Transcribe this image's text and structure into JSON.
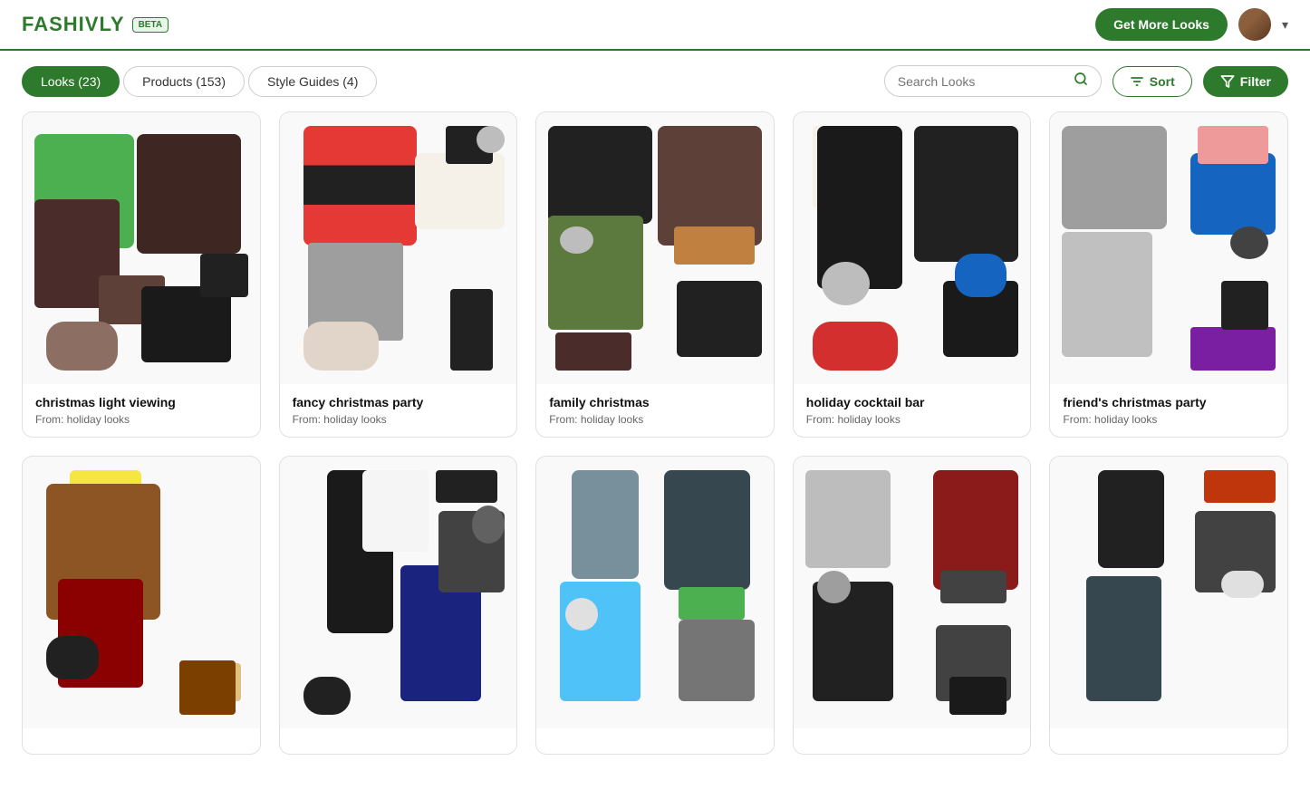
{
  "header": {
    "logo": "FASHIVLY",
    "beta": "BETA",
    "cta_button": "Get More Looks",
    "user_avatar_alt": "User avatar",
    "chevron": "▾"
  },
  "tabs": [
    {
      "id": "looks",
      "label": "Looks (23)",
      "active": true
    },
    {
      "id": "products",
      "label": "Products (153)",
      "active": false
    },
    {
      "id": "style-guides",
      "label": "Style Guides (4)",
      "active": false
    }
  ],
  "search": {
    "placeholder": "Search Looks"
  },
  "toolbar": {
    "sort_label": "Sort",
    "filter_label": "Filter"
  },
  "cards": [
    {
      "id": "card-1",
      "title": "christmas light viewing",
      "subtitle": "From: holiday looks",
      "bg_class": "outfit-bg-1"
    },
    {
      "id": "card-2",
      "title": "fancy christmas party",
      "subtitle": "From: holiday looks",
      "bg_class": "outfit-bg-2"
    },
    {
      "id": "card-3",
      "title": "family christmas",
      "subtitle": "From: holiday looks",
      "bg_class": "outfit-bg-3"
    },
    {
      "id": "card-4",
      "title": "holiday cocktail bar",
      "subtitle": "From: holiday looks",
      "bg_class": "outfit-bg-4"
    },
    {
      "id": "card-5",
      "title": "friend's christmas party",
      "subtitle": "From: holiday looks",
      "bg_class": "outfit-bg-5"
    },
    {
      "id": "card-6",
      "title": "",
      "subtitle": "",
      "bg_class": "outfit-bg-6"
    },
    {
      "id": "card-7",
      "title": "",
      "subtitle": "",
      "bg_class": "outfit-bg-7"
    },
    {
      "id": "card-8",
      "title": "",
      "subtitle": "",
      "bg_class": "outfit-bg-8"
    },
    {
      "id": "card-9",
      "title": "",
      "subtitle": "",
      "bg_class": "outfit-bg-9"
    },
    {
      "id": "card-10",
      "title": "",
      "subtitle": "",
      "bg_class": "outfit-bg-10"
    }
  ]
}
